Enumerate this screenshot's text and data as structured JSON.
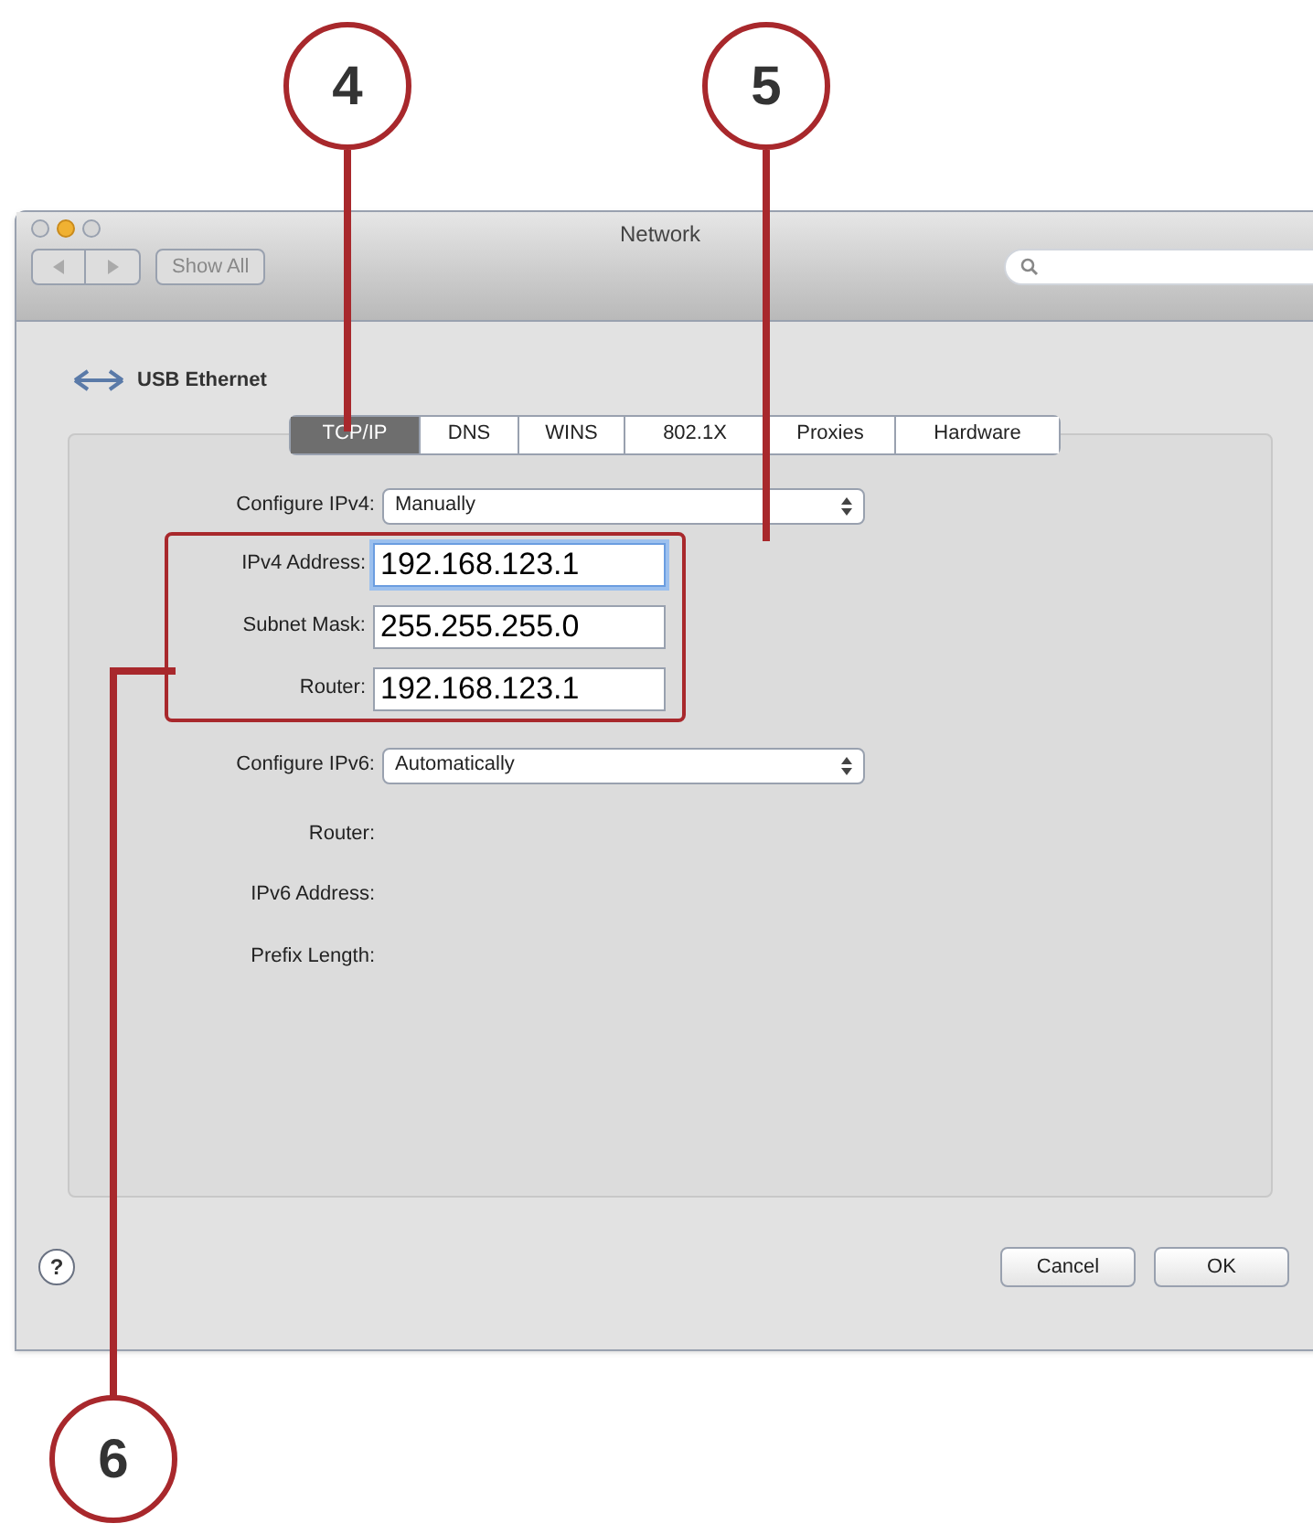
{
  "window": {
    "title": "Network"
  },
  "toolbar": {
    "show_all": "Show All"
  },
  "service": {
    "name": "USB Ethernet"
  },
  "tabs": [
    {
      "label": "TCP/IP",
      "selected": true
    },
    {
      "label": "DNS",
      "selected": false
    },
    {
      "label": "WINS",
      "selected": false
    },
    {
      "label": "802.1X",
      "selected": false
    },
    {
      "label": "Proxies",
      "selected": false
    },
    {
      "label": "Hardware",
      "selected": false
    }
  ],
  "configure_ipv4": {
    "label": "Configure IPv4:",
    "value": "Manually"
  },
  "ipv4_fields": [
    {
      "label": "IPv4 Address:",
      "value": "192.168.123.1",
      "focused": true
    },
    {
      "label": "Subnet Mask:",
      "value": "255.255.255.0",
      "focused": false
    },
    {
      "label": "Router:",
      "value": "192.168.123.1",
      "focused": false
    }
  ],
  "configure_ipv6": {
    "label": "Configure IPv6:",
    "value": "Automatically"
  },
  "ipv6_labels": [
    "Router:",
    "IPv6 Address:",
    "Prefix Length:"
  ],
  "help_button": "?",
  "buttons": [
    "Cancel",
    "OK"
  ],
  "callouts": [
    "4",
    "5",
    "6"
  ]
}
